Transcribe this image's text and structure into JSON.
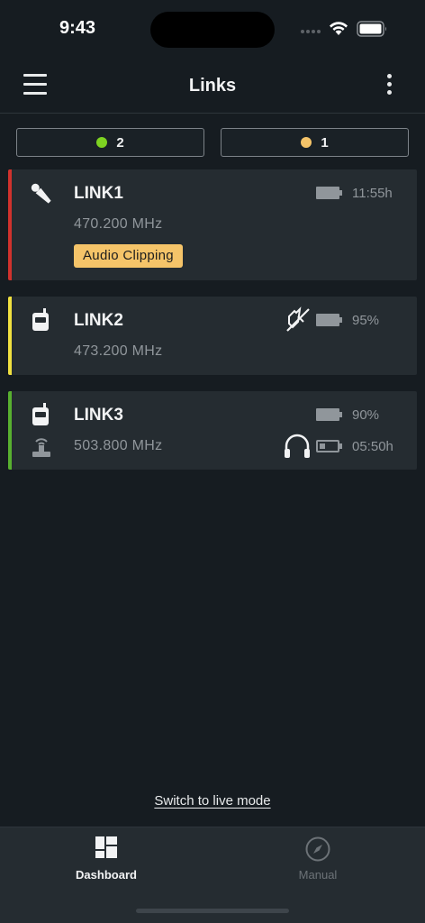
{
  "status_bar": {
    "time": "9:43",
    "icons": [
      "signal-icon",
      "wifi-icon",
      "battery-icon"
    ]
  },
  "header": {
    "title": "Links",
    "menu_icon": "hamburger-menu-icon",
    "more_icon": "more-vertical-icon"
  },
  "filters": [
    {
      "count": "2",
      "color": "#7ed321",
      "status": "ok"
    },
    {
      "count": "1",
      "color": "#f5c469",
      "status": "warning"
    }
  ],
  "links": [
    {
      "name": "LINK1",
      "frequency": "470.200 MHz",
      "status_color": "#d0322d",
      "device_icon": "handheld-microphone-icon",
      "battery_text": "11:55h",
      "alert": "Audio Clipping"
    },
    {
      "name": "LINK2",
      "frequency": "473.200 MHz",
      "status_color": "#f0e040",
      "device_icon": "bodypack-transmitter-icon",
      "mute_icon": "muted-microphone-icon",
      "battery_text": "95%"
    },
    {
      "name": "LINK3",
      "frequency": "503.800 MHz",
      "status_color": "#58b030",
      "device_icon": "bodypack-transmitter-icon",
      "receiver_icon": "wireless-receiver-icon",
      "battery_text": "90%",
      "headphone_icon": "headphones-icon",
      "headphone_battery_text": "05:50h"
    }
  ],
  "footer": {
    "live_mode_link": "Switch to live mode"
  },
  "tabs": [
    {
      "label": "Dashboard",
      "icon": "dashboard-grid-icon",
      "active": true
    },
    {
      "label": "Manual",
      "icon": "compass-icon",
      "active": false
    }
  ]
}
